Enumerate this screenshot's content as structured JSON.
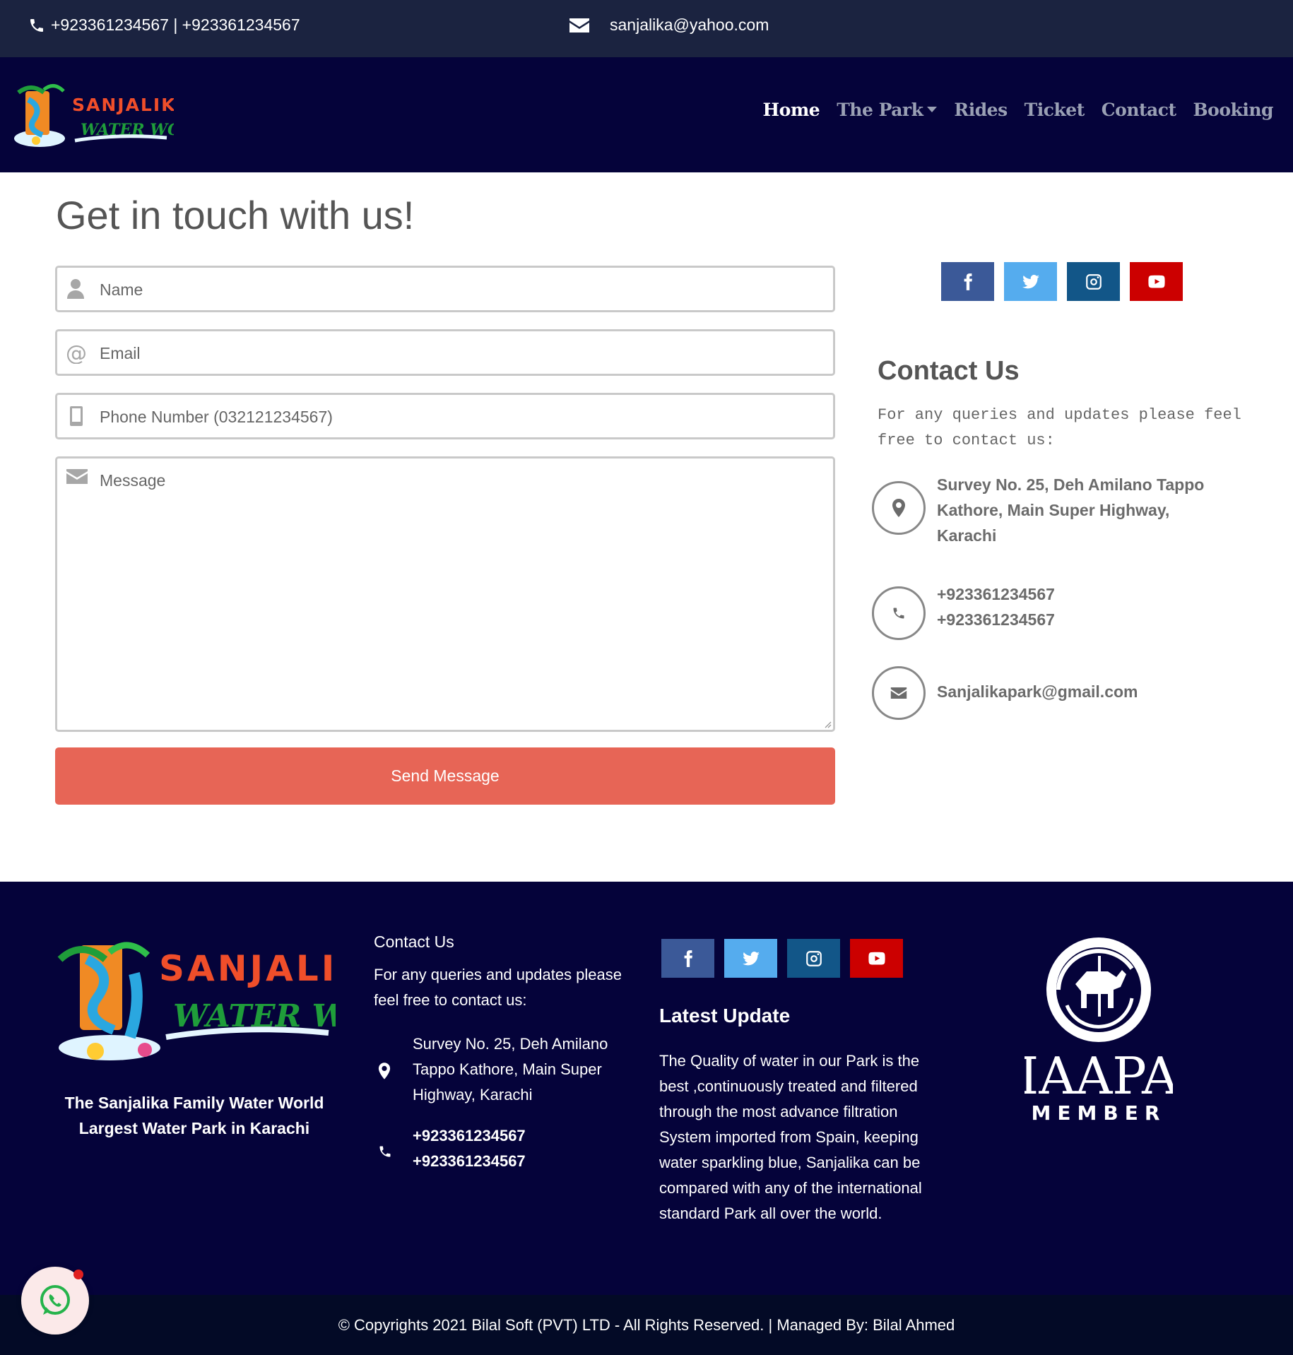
{
  "topbar": {
    "phones": "+923361234567 | +923361234567",
    "email": "sanjalika@yahoo.com"
  },
  "nav": {
    "logo_text": "SANJALIKA",
    "logo_sub": "WATER WORLD",
    "items": [
      {
        "label": "Home"
      },
      {
        "label": "The Park"
      },
      {
        "label": "Rides"
      },
      {
        "label": "Ticket"
      },
      {
        "label": "Contact"
      },
      {
        "label": "Booking"
      }
    ]
  },
  "main": {
    "title": "Get in touch with us!",
    "form": {
      "name_placeholder": "Name",
      "email_placeholder": "Email",
      "phone_placeholder": "Phone Number (032121234567)",
      "message_placeholder": "Message",
      "send_label": "Send Message"
    },
    "contact": {
      "title": "Contact Us",
      "desc": "For any queries and updates please feel free to contact us:",
      "address": "Survey No. 25, Deh Amilano Tappo Kathore, Main Super Highway, Karachi",
      "phone1": "+923361234567",
      "phone2": "+923361234567",
      "email": "Sanjalikapark@gmail.com"
    }
  },
  "footer": {
    "tagline1": "The Sanjalika Family Water World",
    "tagline2": "Largest Water Park in Karachi",
    "contact_title": "Contact Us",
    "contact_desc": "For any queries and updates please feel free to contact us:",
    "address": "Survey No. 25, Deh Amilano Tappo Kathore, Main Super Highway, Karachi",
    "phone1": "+923361234567",
    "phone2": "+923361234567",
    "latest_title": "Latest Update",
    "latest_body": "The Quality of water in our Park is the best ,continuously treated and filtered through the most advance filtration System imported from Spain, keeping water sparkling blue, Sanjalika can be compared with any of the international standard Park all over the world.",
    "iaapa_word": "IAAPA",
    "iaapa_member": "MEMBER",
    "copyright": "© Copyrights 2021 Bilal Soft (PVT) LTD - All Rights Reserved. | Managed By: Bilal Ahmed"
  },
  "colors": {
    "topbar": "#1b2340",
    "nav": "#05033a",
    "send": "#e76556",
    "facebook": "#3b5998",
    "twitter": "#55acee",
    "instagram": "#125688",
    "youtube": "#cc0000"
  }
}
